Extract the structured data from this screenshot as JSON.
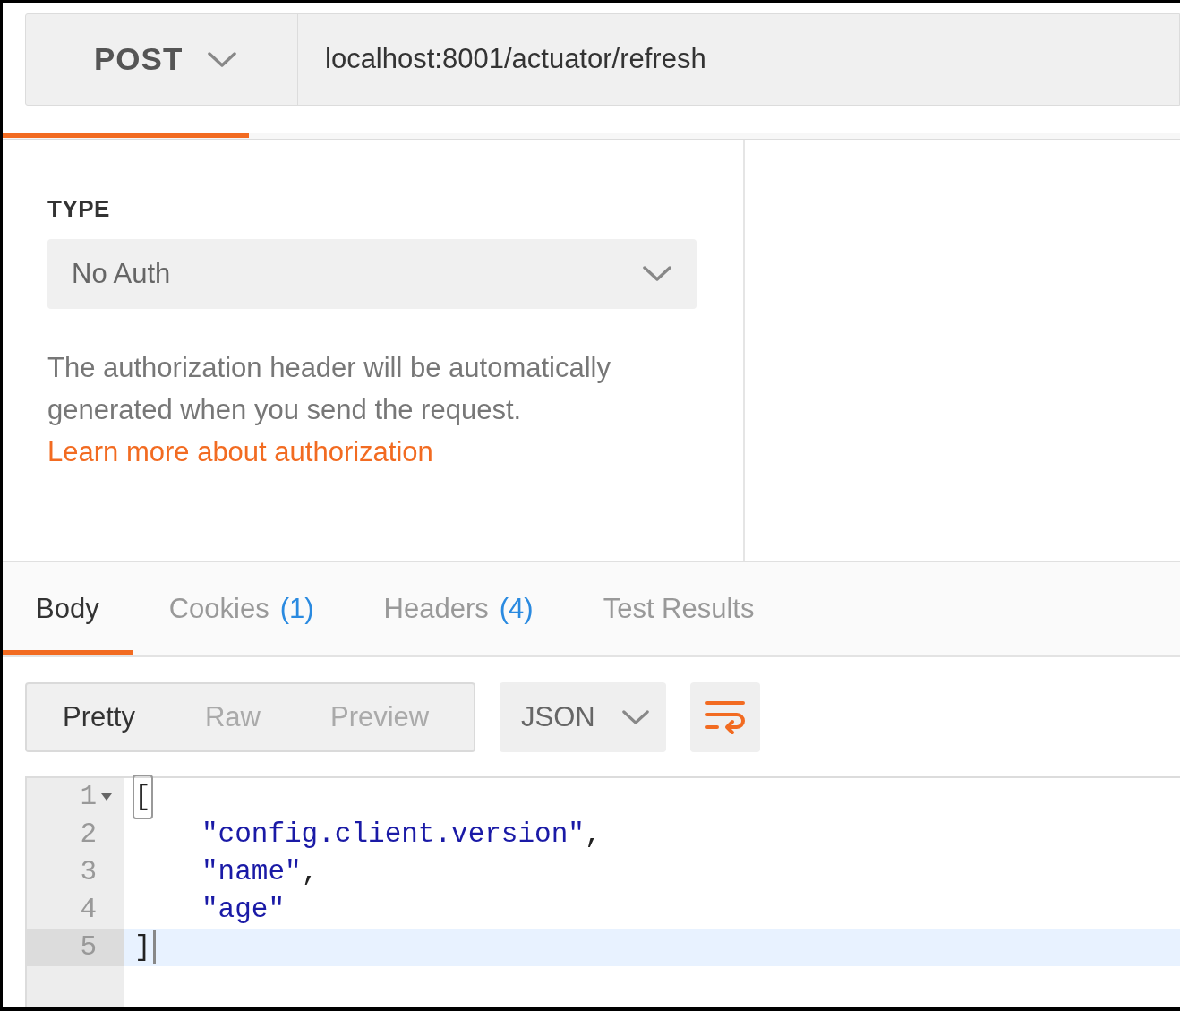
{
  "request": {
    "method": "POST",
    "url": "localhost:8001/actuator/refresh"
  },
  "auth": {
    "type_label": "TYPE",
    "type": "No Auth",
    "description": "The authorization header will be automatically generated when you send the request.",
    "link": "Learn more about authorization"
  },
  "response_tabs": [
    {
      "label": "Body",
      "selected": true
    },
    {
      "label": "Cookies",
      "count": "(1)",
      "selected": false
    },
    {
      "label": "Headers",
      "count": "(4)",
      "selected": false
    },
    {
      "label": "Test Results",
      "selected": false
    }
  ],
  "view_modes": [
    {
      "label": "Pretty",
      "selected": true
    },
    {
      "label": "Raw",
      "selected": false
    },
    {
      "label": "Preview",
      "selected": false
    }
  ],
  "format": "JSON",
  "code": {
    "lines": [
      {
        "number": "1",
        "foldable": true,
        "indented": false,
        "selected": false,
        "tokens": [
          {
            "kind": "punct",
            "text": "[",
            "matched": true
          }
        ]
      },
      {
        "number": "2",
        "foldable": false,
        "indented": true,
        "selected": false,
        "tokens": [
          {
            "kind": "string",
            "text": "\"config.client.version\""
          },
          {
            "kind": "punct",
            "text": ","
          }
        ]
      },
      {
        "number": "3",
        "foldable": false,
        "indented": true,
        "selected": false,
        "tokens": [
          {
            "kind": "string",
            "text": "\"name\""
          },
          {
            "kind": "punct",
            "text": ","
          }
        ]
      },
      {
        "number": "4",
        "foldable": false,
        "indented": true,
        "selected": false,
        "tokens": [
          {
            "kind": "string",
            "text": "\"age\""
          }
        ]
      },
      {
        "number": "5",
        "foldable": false,
        "indented": false,
        "selected": true,
        "tokens": [
          {
            "kind": "punct",
            "text": "]"
          }
        ]
      }
    ]
  }
}
